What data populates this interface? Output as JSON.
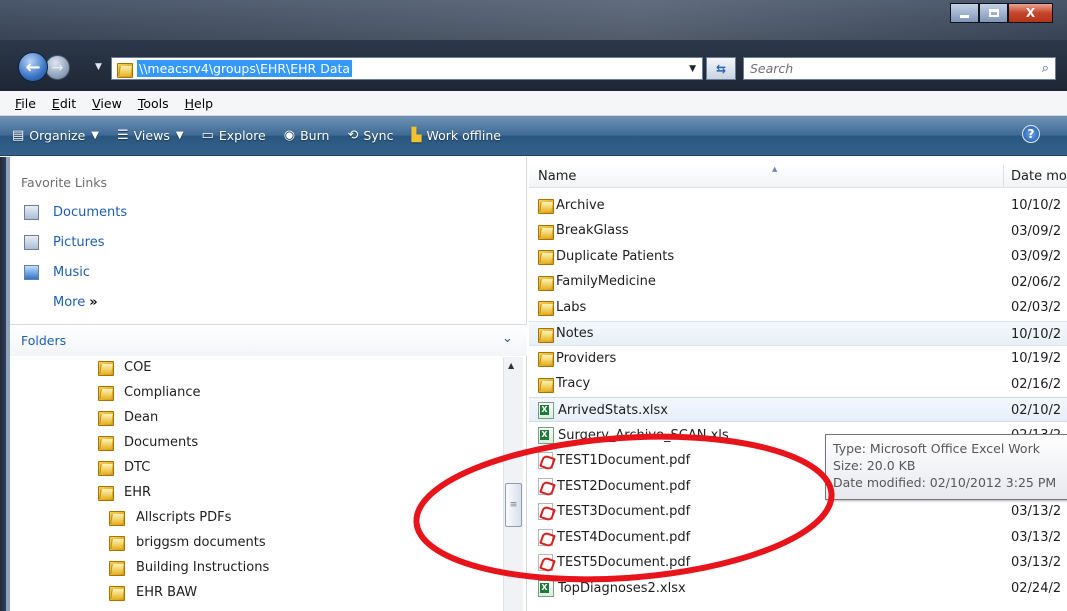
{
  "window": {
    "controls": {
      "minimize": "minimize",
      "maximize": "maximize",
      "close": "X"
    }
  },
  "address": {
    "path": "\\\\meacsrv4\\groups\\EHR\\EHR Data",
    "search_placeholder": "Search"
  },
  "menu": [
    {
      "key": "F",
      "rest": "ile"
    },
    {
      "key": "E",
      "rest": "dit"
    },
    {
      "key": "V",
      "rest": "iew"
    },
    {
      "key": "T",
      "rest": "ools"
    },
    {
      "key": "H",
      "rest": "elp"
    }
  ],
  "toolbar": {
    "organize": "Organize",
    "views": "Views",
    "explore": "Explore",
    "burn": "Burn",
    "sync": "Sync",
    "work_offline": "Work offline",
    "help": "?"
  },
  "favorites": {
    "title": "Favorite Links",
    "items": [
      "Documents",
      "Pictures",
      "Music"
    ],
    "more": "More",
    "more_glyph": "»"
  },
  "folders": {
    "title": "Folders",
    "tree": [
      {
        "label": "COE",
        "level": 1
      },
      {
        "label": "Compliance",
        "level": 1
      },
      {
        "label": "Dean",
        "level": 1
      },
      {
        "label": "Documents",
        "level": 1
      },
      {
        "label": "DTC",
        "level": 1
      },
      {
        "label": "EHR",
        "level": 1
      },
      {
        "label": "Allscripts PDFs",
        "level": 2
      },
      {
        "label": "briggsm documents",
        "level": 2
      },
      {
        "label": "Building Instructions",
        "level": 2
      },
      {
        "label": "EHR BAW",
        "level": 2
      }
    ]
  },
  "files": {
    "columns": {
      "name": "Name",
      "date": "Date mo"
    },
    "rows": [
      {
        "name": "Archive",
        "date": "10/10/2",
        "type": "folder"
      },
      {
        "name": "BreakGlass",
        "date": "03/09/2",
        "type": "folder"
      },
      {
        "name": "Duplicate Patients",
        "date": "03/09/2",
        "type": "folder"
      },
      {
        "name": "FamilyMedicine",
        "date": "02/06/2",
        "type": "folder"
      },
      {
        "name": "Labs",
        "date": "02/03/2",
        "type": "folder"
      },
      {
        "name": "Notes",
        "date": "10/10/2",
        "type": "folder",
        "state": "hover"
      },
      {
        "name": "Providers",
        "date": "10/19/2",
        "type": "folder"
      },
      {
        "name": "Tracy",
        "date": "02/16/2",
        "type": "folder"
      },
      {
        "name": "ArrivedStats.xlsx",
        "date": "02/10/2",
        "type": "xls",
        "state": "sel"
      },
      {
        "name": "Surgery_Archive_SCAN.xls",
        "date": "02/13/2",
        "type": "xls"
      },
      {
        "name": "TEST1Document.pdf",
        "date": "",
        "type": "pdf"
      },
      {
        "name": "TEST2Document.pdf",
        "date": "",
        "type": "pdf"
      },
      {
        "name": "TEST3Document.pdf",
        "date": "03/13/2",
        "type": "pdf"
      },
      {
        "name": "TEST4Document.pdf",
        "date": "03/13/2",
        "type": "pdf"
      },
      {
        "name": "TEST5Document.pdf",
        "date": "03/13/2",
        "type": "pdf"
      },
      {
        "name": "TopDiagnoses2.xlsx",
        "date": "02/24/2",
        "type": "xls"
      }
    ]
  },
  "tooltip": {
    "type": "Type: Microsoft Office Excel Work",
    "size": "Size: 20.0 KB",
    "modified": "Date modified: 02/10/2012 3:25 PM"
  },
  "colors": {
    "annotation_ellipse": "#e8141b",
    "toolbar": "#3d6a94",
    "selection": "#3399ff"
  }
}
